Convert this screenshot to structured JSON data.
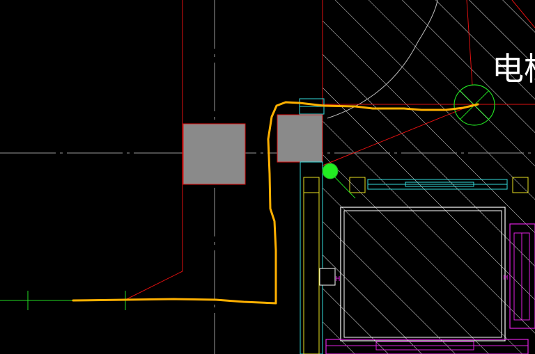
{
  "drawing": {
    "room_label": "电梯",
    "colors": {
      "background": "#000000",
      "route_line": "#ffb000",
      "column_fill": "#8a8a8a",
      "red_line": "#e01010",
      "hatch": "#ffffff",
      "cyan": "#33dddd",
      "magenta": "#e020e0",
      "yellow": "#e8e020",
      "green": "#22dd22",
      "green_marker": "#22ee22"
    },
    "icons": {
      "column": "column-block",
      "marker": "green-circle-marker",
      "crosshair": "center-crosshair"
    }
  }
}
